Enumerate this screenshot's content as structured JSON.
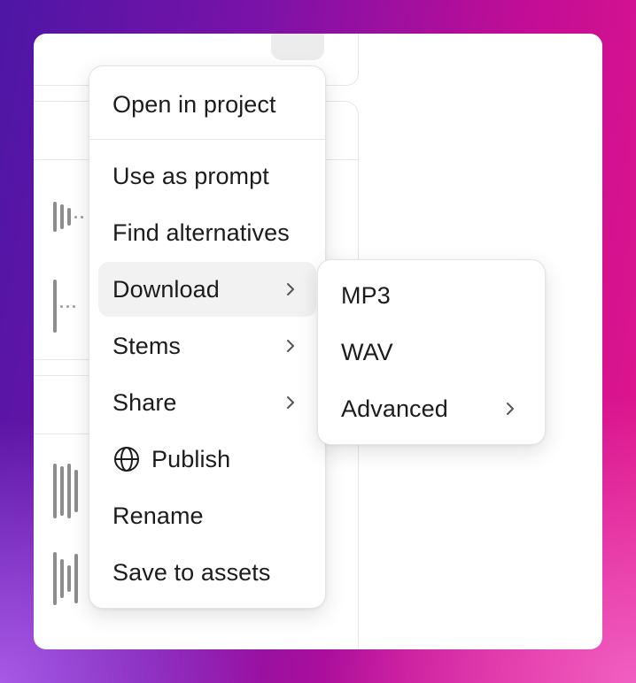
{
  "menu": {
    "items": [
      {
        "label": "Open in project"
      },
      {
        "label": "Use as prompt"
      },
      {
        "label": "Find alternatives"
      },
      {
        "label": "Download"
      },
      {
        "label": "Stems"
      },
      {
        "label": "Share"
      },
      {
        "label": "Publish"
      },
      {
        "label": "Rename"
      },
      {
        "label": "Save to assets"
      }
    ]
  },
  "submenu": {
    "parent": "Download",
    "items": [
      {
        "label": "MP3"
      },
      {
        "label": "WAV"
      },
      {
        "label": "Advanced"
      }
    ]
  },
  "icons": {
    "publish": "globe-icon",
    "submenu_indicator": "chevron-right-icon",
    "track_thumbnail": "waveform-icon"
  },
  "colors": {
    "background_gradient": [
      "#4d16a5",
      "#c20d96",
      "#f05fc2"
    ],
    "card": "#ffffff",
    "menu_text": "#1c1c1c",
    "active_item": "#f2f2f2"
  }
}
